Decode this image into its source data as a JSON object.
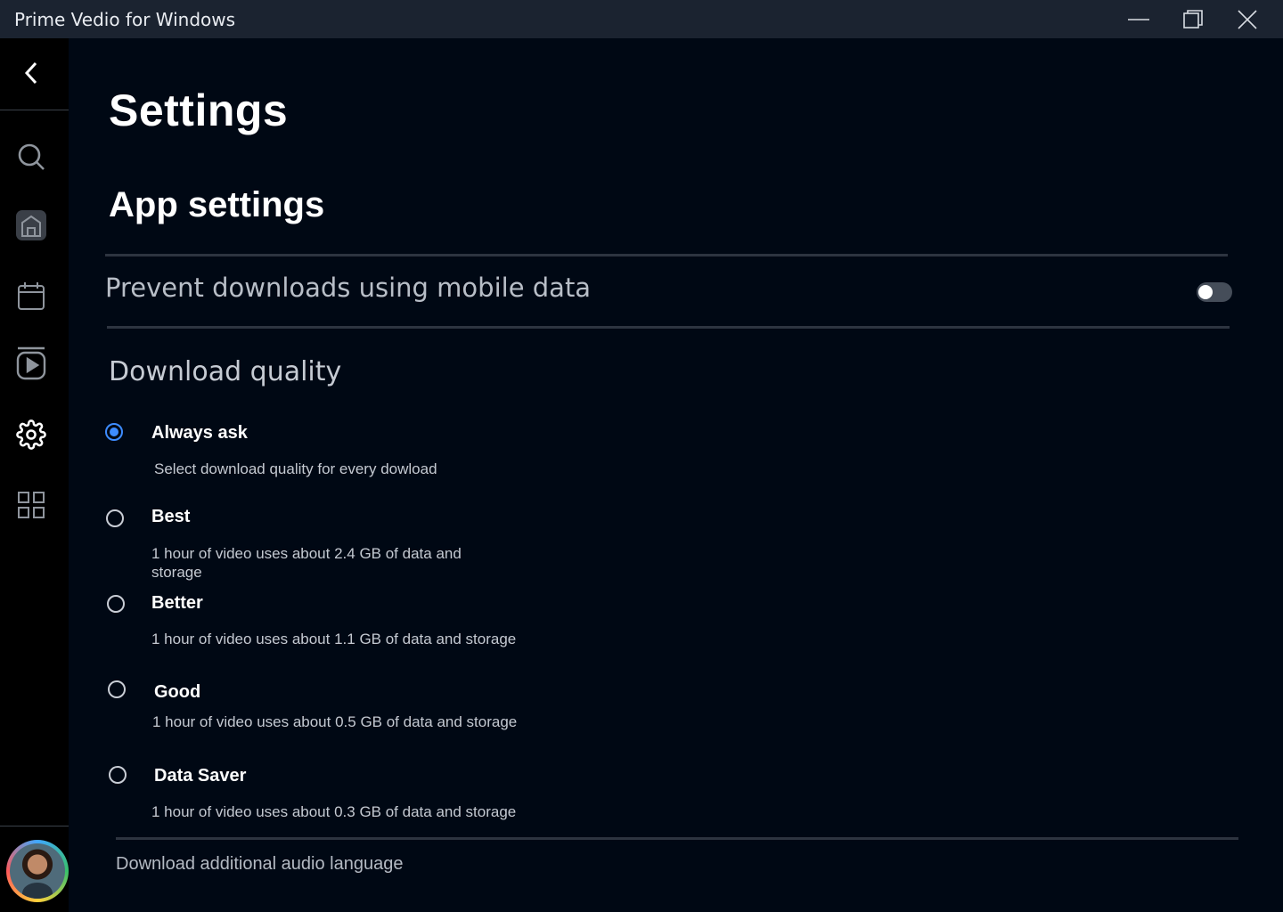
{
  "window": {
    "title": "Prime Vedio for Windows",
    "minimize_icon": "minimize-icon",
    "maximize_icon": "restore-icon",
    "close_icon": "close-icon"
  },
  "sidebar": {
    "items": [
      {
        "name": "back",
        "icon": "chevron-left-icon"
      },
      {
        "name": "search",
        "icon": "search-icon"
      },
      {
        "name": "home",
        "icon": "home-icon"
      },
      {
        "name": "calendar",
        "icon": "calendar-icon"
      },
      {
        "name": "library",
        "icon": "video-library-icon"
      },
      {
        "name": "settings",
        "icon": "gear-icon",
        "active": true
      },
      {
        "name": "categories",
        "icon": "grid-icon"
      }
    ],
    "avatar": "user-avatar"
  },
  "page": {
    "title": "Settings",
    "section_title": "App settings",
    "mobile_data": {
      "label": "Prevent downloads using mobile data",
      "enabled": false
    },
    "download_quality": {
      "title": "Download quality",
      "selected": "Always ask",
      "options": [
        {
          "label": "Always ask",
          "description": "Select download quality for every dowload"
        },
        {
          "label": "Best",
          "description": "1 hour of video uses about 2.4 GB of data and storage"
        },
        {
          "label": "Better",
          "description": "1 hour of video uses about 1.1 GB of data and storage"
        },
        {
          "label": "Good",
          "description": "1 hour of video uses about 0.5 GB of data and storage"
        },
        {
          "label": "Data Saver",
          "description": "1 hour of video uses about 0.3 GB of data and storage"
        }
      ]
    },
    "audio_language_label": "Download additional audio language"
  },
  "colors": {
    "background": "#000814",
    "titlebar": "#1b2330",
    "sidebar": "#000000",
    "accent": "#3d8cff"
  }
}
